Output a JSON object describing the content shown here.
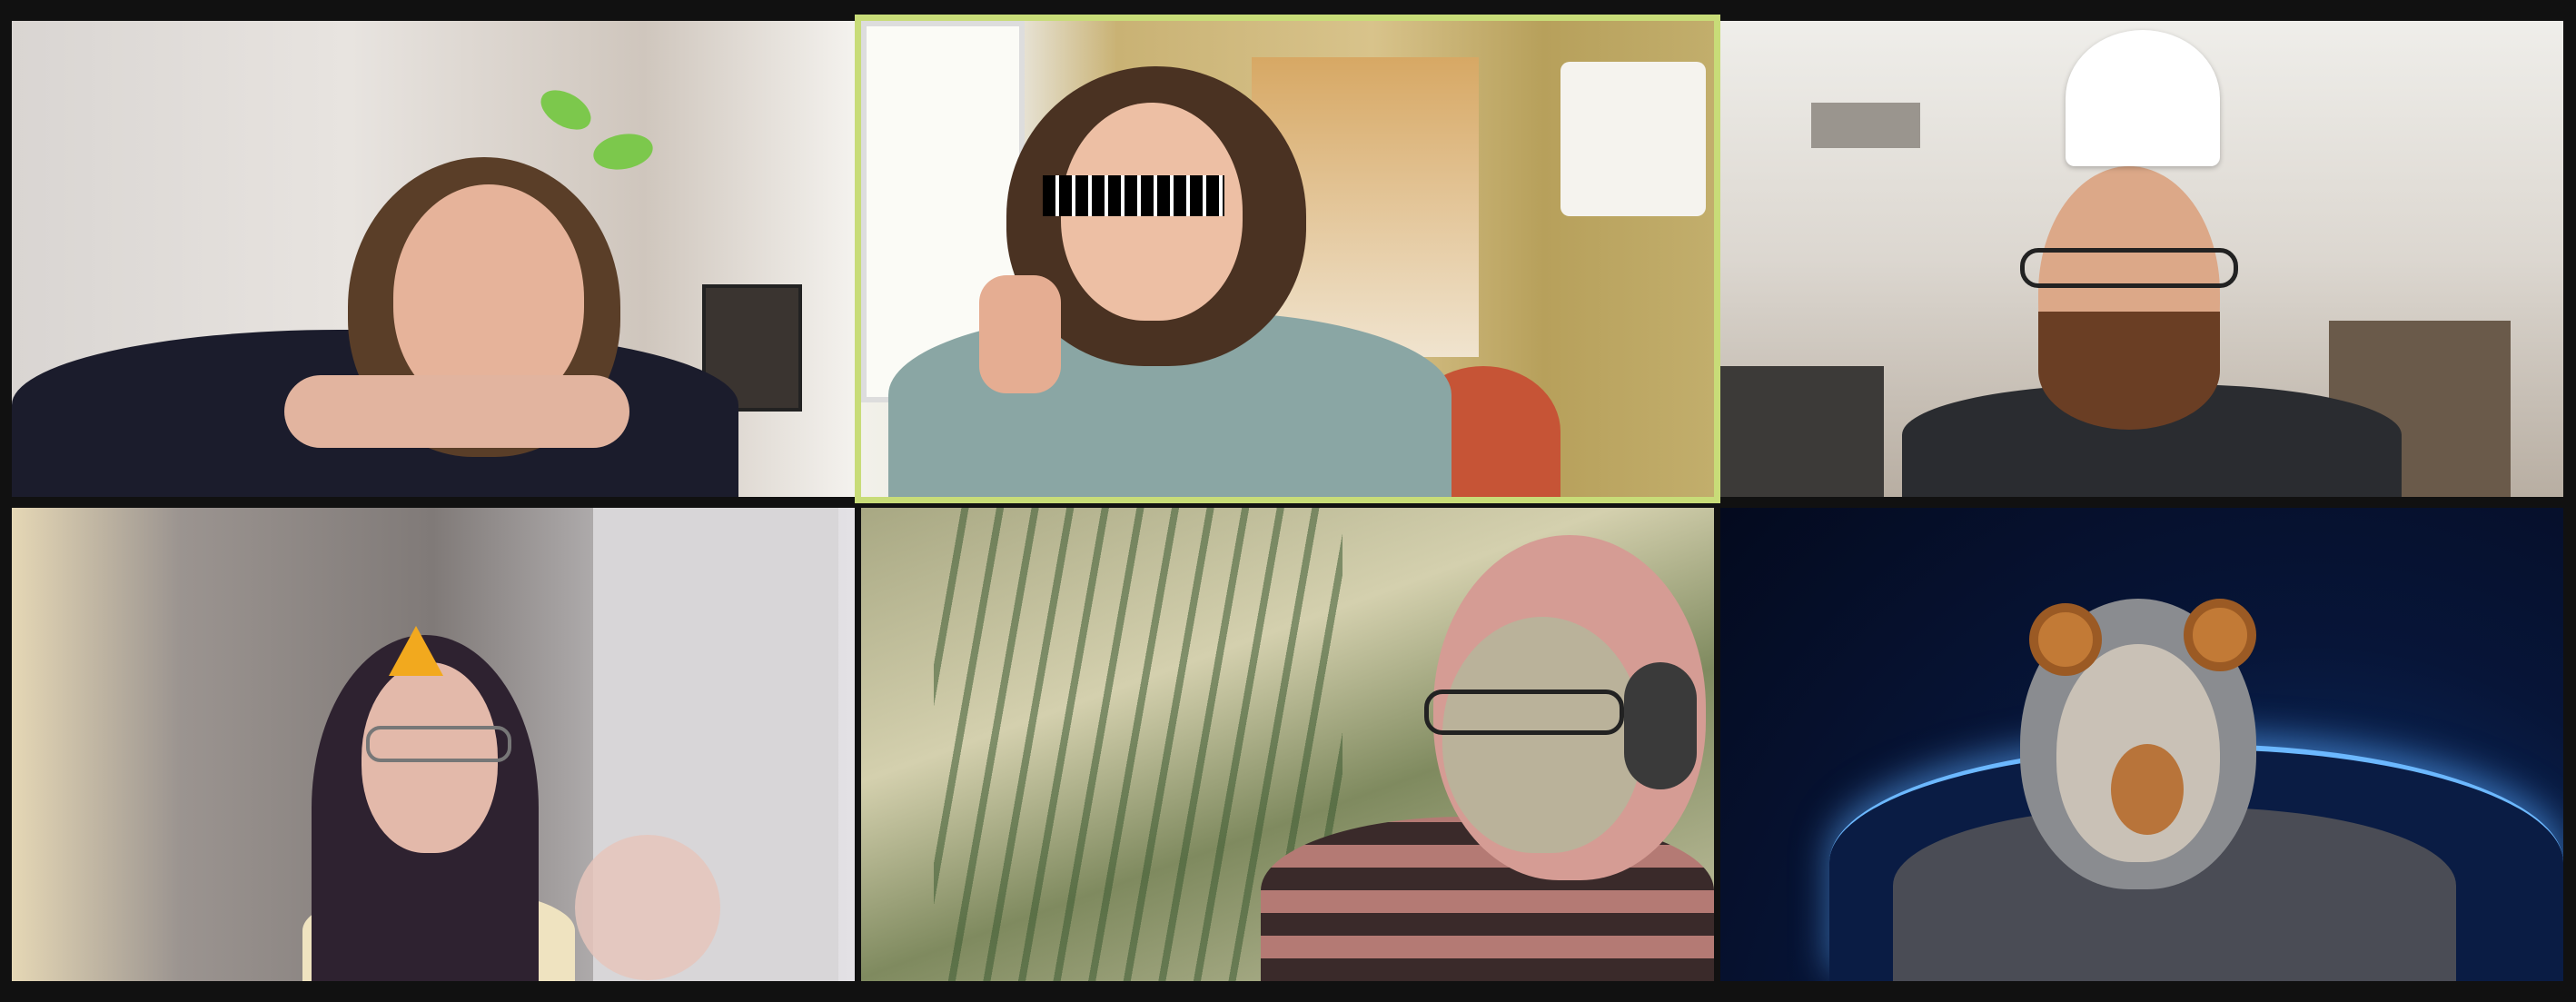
{
  "app": "video-meeting-gallery-view",
  "layout": {
    "rows": 2,
    "columns": 3
  },
  "colors": {
    "background": "#111111",
    "active_speaker_border": "#c8dc78"
  },
  "participants": [
    {
      "filter": "sprout-headband-icon",
      "active_speaker": false
    },
    {
      "filter": "pixel-sunglasses-icon",
      "active_speaker": true
    },
    {
      "filter": "chef-hat-icon",
      "active_speaker": false
    },
    {
      "filter": "party-hat-icon",
      "active_speaker": false
    },
    {
      "filter": "grass-background",
      "active_speaker": false
    },
    {
      "filter": "bear-face-icon",
      "active_speaker": false
    }
  ]
}
